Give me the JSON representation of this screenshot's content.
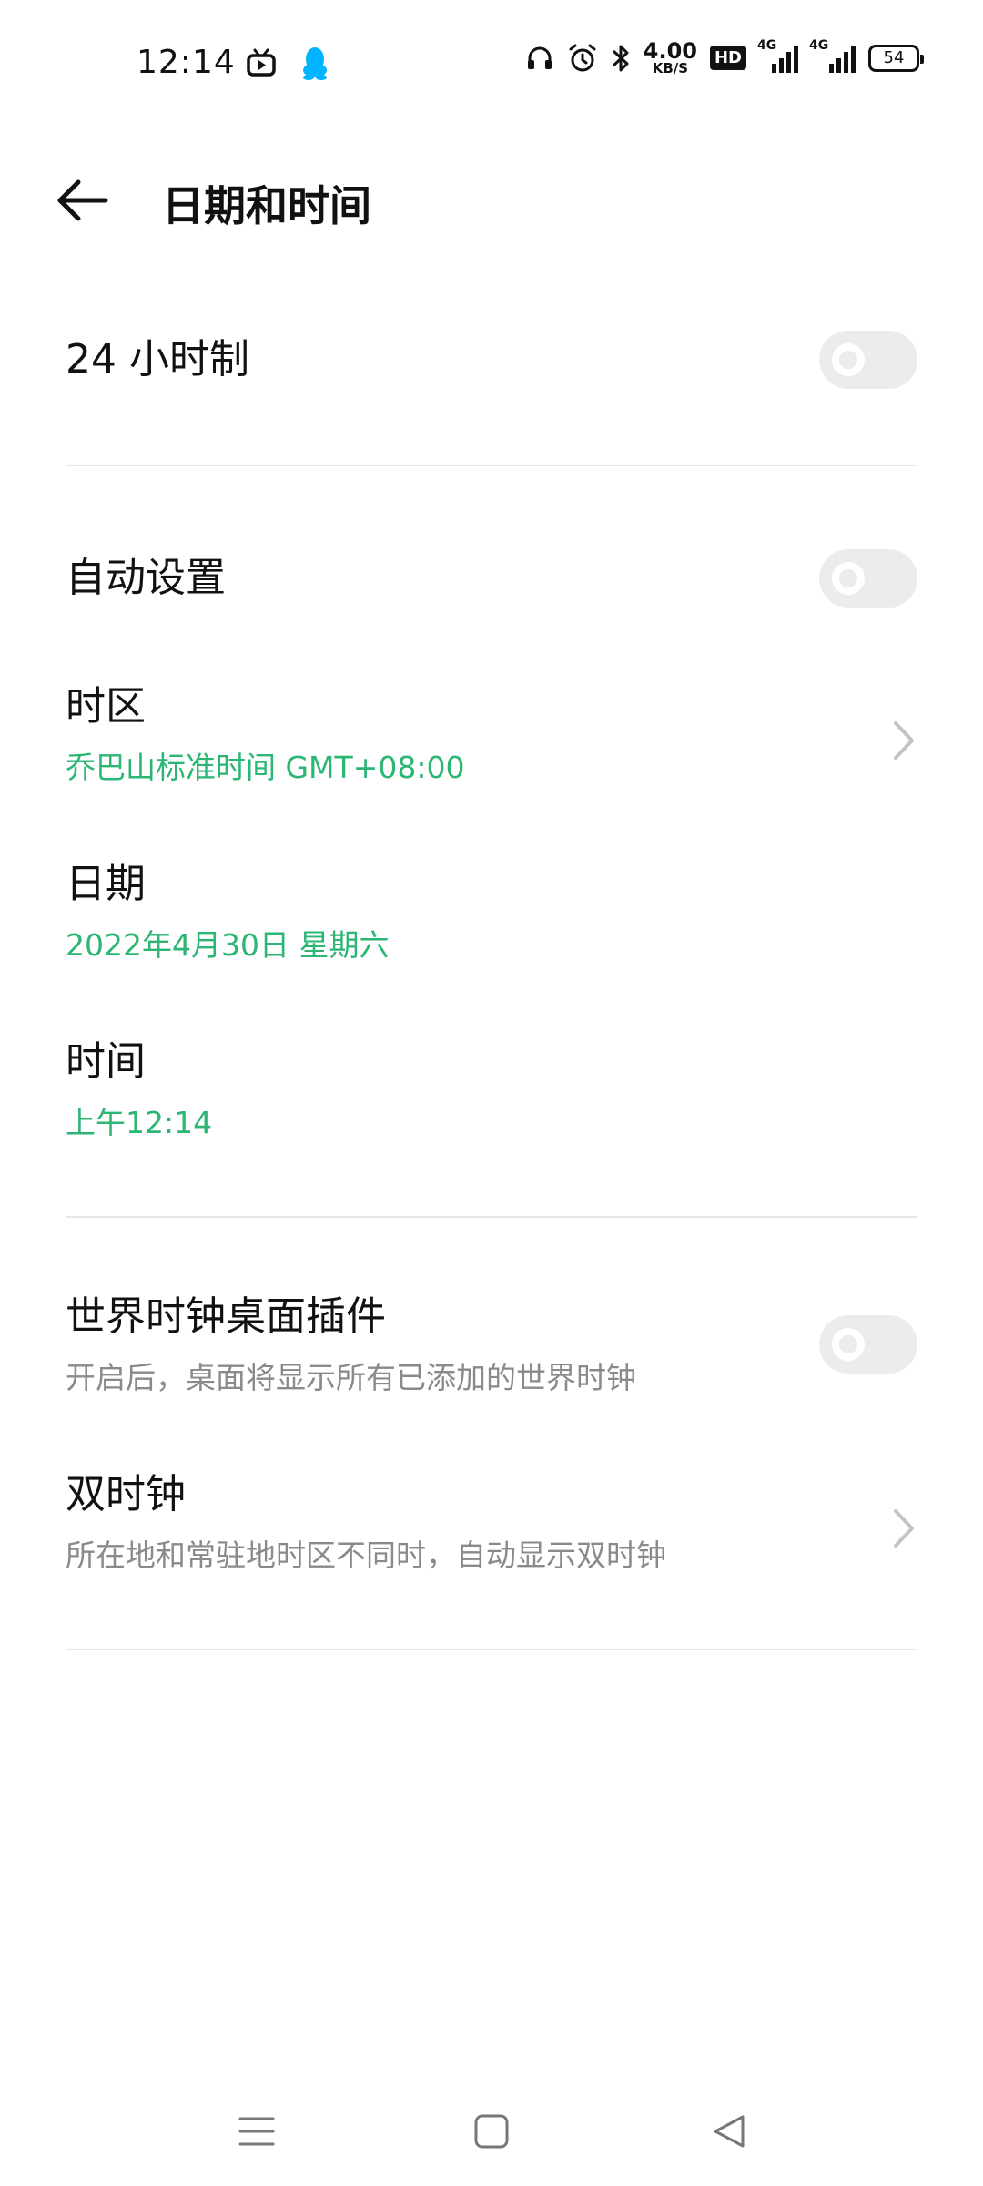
{
  "status_bar": {
    "time": "12:14",
    "left_icons": [
      "bilibili-icon",
      "qq-penguin-icon"
    ],
    "right_icons": [
      "headphones-icon",
      "alarm-icon",
      "bluetooth-icon"
    ],
    "net_speed_value": "4.00",
    "net_speed_unit": "KB/S",
    "hd_label": "HD",
    "sim1_label": "4G",
    "sim2_label": "4G",
    "battery": "54",
    "accent_qq": "#00b4ff"
  },
  "header": {
    "title": "日期和时间",
    "back_icon": "arrow-left-icon"
  },
  "settings": {
    "hour24": {
      "label": "24 小时制",
      "enabled": false
    },
    "auto_set": {
      "label": "自动设置",
      "enabled": false
    },
    "timezone": {
      "label": "时区",
      "value": "乔巴山标准时间 GMT+08:00"
    },
    "date": {
      "label": "日期",
      "value": "2022年4月30日 星期六"
    },
    "time": {
      "label": "时间",
      "value": "上午12:14"
    },
    "world_clock_widget": {
      "label": "世界时钟桌面插件",
      "description": "开启后，桌面将显示所有已添加的世界时钟",
      "enabled": false
    },
    "dual_clock": {
      "label": "双时钟",
      "description": "所在地和常驻地时区不同时，自动显示双时钟"
    }
  },
  "colors": {
    "accent": "#2bb673",
    "toggle_off": "#ececec",
    "muted_text": "#8a8a8a",
    "divider": "#e6e6e6"
  },
  "nav_bar": {
    "buttons": [
      "menu-icon",
      "home-square-icon",
      "back-triangle-icon"
    ]
  }
}
